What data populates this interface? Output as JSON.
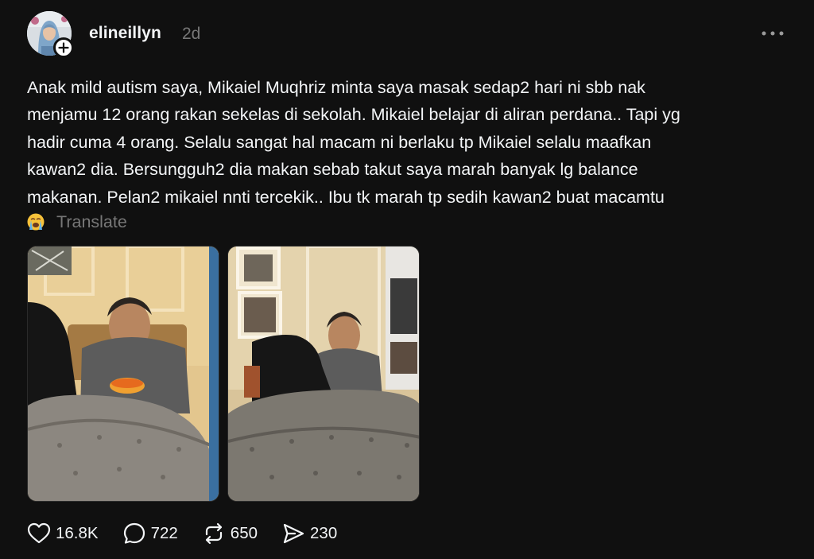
{
  "post": {
    "username": "elineillyn",
    "timestamp": "2d",
    "caption_lines": [
      "Anak mild autism saya, Mikaiel Muqhriz minta saya masak sedap2 hari ni sbb nak",
      "menjamu 12 orang rakan sekelas di sekolah. Mikaiel belajar di aliran perdana.. Tapi yg",
      "hadir cuma 4 orang. Selalu sangat hal macam ni berlaku tp Mikaiel selalu maafkan",
      "kawan2 dia. Bersungguh2 dia makan sebab takut saya marah banyak lg balance",
      "makanan. Pelan2 mikaiel nnti tercekik.. Ibu tk marah tp sedih kawan2 buat macamtu"
    ],
    "emoji": "loudly-crying-face",
    "translate_label": "Translate",
    "images": [
      {
        "icon": "photo-boy-eating-at-table"
      },
      {
        "icon": "photo-boy-sitting-beside-woman-on-sofa"
      }
    ]
  },
  "actions": {
    "likes": "16.8K",
    "replies": "722",
    "reposts": "650",
    "shares": "230"
  },
  "colors": {
    "background": "#101010",
    "text_primary": "#f3f5f7",
    "text_secondary": "#777777"
  }
}
